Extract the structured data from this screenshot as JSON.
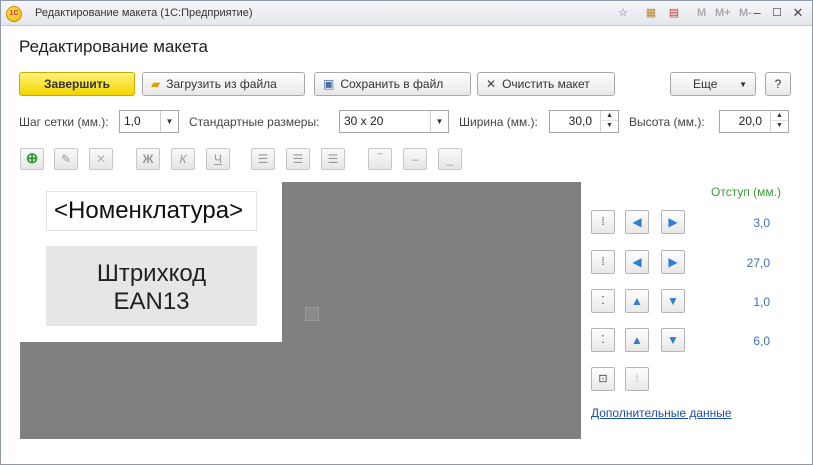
{
  "window": {
    "title": "Редактирование макета  (1С:Предприятие)",
    "app_icon_text": "1С",
    "toolbar_texts": [
      "M",
      "M+",
      "M-"
    ]
  },
  "form": {
    "title": "Редактирование макета"
  },
  "actions": {
    "finish": "Завершить",
    "load": "Загрузить из файла",
    "save": "Сохранить в файл",
    "clear": "Очистить макет",
    "more": "Еще",
    "help": "?"
  },
  "settings": {
    "grid_label": "Шаг сетки (мм.):",
    "grid_value": "1,0",
    "std_sizes_label": "Стандартные размеры:",
    "std_sizes_value": "30 x 20",
    "width_label": "Ширина (мм.):",
    "width_value": "30,0",
    "height_label": "Высота (мм.):",
    "height_value": "20,0"
  },
  "format_tools": {
    "bold": "Ж",
    "italic": "К",
    "underline": "Ч"
  },
  "canvas": {
    "text_element": "<Номенклатура>",
    "barcode_line1": "Штрихкод",
    "barcode_line2": "EAN13"
  },
  "indents": {
    "title": "Отступ (мм.)",
    "left": "3,0",
    "right": "27,0",
    "top": "1,0",
    "bottom": "6,0"
  },
  "link": "Дополнительные данные",
  "colors": {
    "primary_button": "#f2d600",
    "canvas_bg": "#808080",
    "indent_title": "#3a9a3a",
    "indent_value": "#3e6fb8",
    "link": "#1d4fa8"
  },
  "icons": {
    "add": "add-icon",
    "edit": "pencil-icon",
    "delete": "delete-icon",
    "align_left": "align-left-icon",
    "align_center": "align-center-icon",
    "align_right": "align-right-icon",
    "valign_top": "valign-top-icon",
    "valign_middle": "valign-middle-icon",
    "valign_bottom": "valign-bottom-icon"
  }
}
